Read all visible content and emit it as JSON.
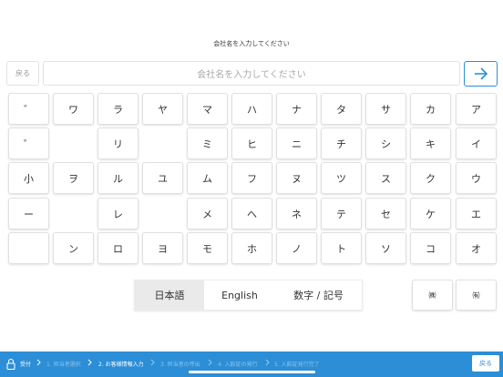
{
  "prompt": "会社名を入力してください",
  "back_button": "戻る",
  "input": {
    "placeholder": "会社名を入力してください",
    "value": ""
  },
  "go_button_icon": "arrow-right-icon",
  "keyboard": {
    "rows": [
      [
        "゛",
        "ワ",
        "ラ",
        "ヤ",
        "マ",
        "ハ",
        "ナ",
        "タ",
        "サ",
        "カ",
        "ア"
      ],
      [
        "゜",
        "",
        "リ",
        "",
        "ミ",
        "ヒ",
        "ニ",
        "チ",
        "シ",
        "キ",
        "イ"
      ],
      [
        "小",
        "ヲ",
        "ル",
        "ユ",
        "ム",
        "フ",
        "ヌ",
        "ツ",
        "ス",
        "ク",
        "ウ"
      ],
      [
        "ー",
        "",
        "レ",
        "",
        "メ",
        "ヘ",
        "ネ",
        "テ",
        "セ",
        "ケ",
        "エ"
      ],
      [
        "",
        "ン",
        "ロ",
        "ヨ",
        "モ",
        "ホ",
        "ノ",
        "ト",
        "ソ",
        "コ",
        "オ"
      ]
    ]
  },
  "language_tabs": [
    {
      "label": "日本語",
      "active": true
    },
    {
      "label": "English",
      "active": false
    },
    {
      "label": "数字 / 記号",
      "active": false
    }
  ],
  "special_keys": [
    "㈱",
    "㈲"
  ],
  "steps": [
    {
      "label": "受付",
      "state": "done"
    },
    {
      "label": "1. 担当者選択",
      "state": "pending"
    },
    {
      "label": "2. お客様情報入力",
      "state": "current"
    },
    {
      "label": "3. 担当者の呼出",
      "state": "pending"
    },
    {
      "label": "4. 入館証の発行",
      "state": "pending"
    },
    {
      "label": "5. 入館証発行完了",
      "state": "pending"
    }
  ],
  "bar_back_button": "戻る",
  "colors": {
    "accent": "#2c8ed6",
    "key_border": "#e0e0e0",
    "active_tab": "#eaeaea"
  }
}
